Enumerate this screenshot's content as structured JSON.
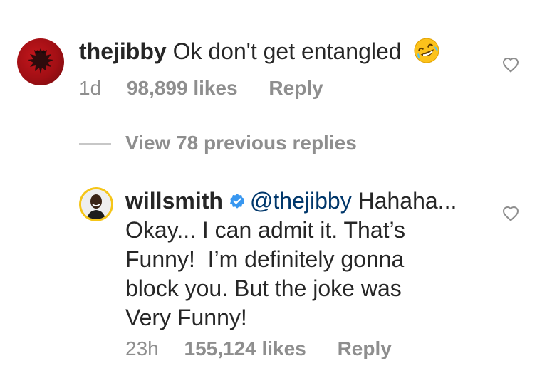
{
  "comment": {
    "username": "thejibby",
    "text": "Ok don't get entangled",
    "emoji": "rolling-on-floor-laughing-emoji",
    "time": "1d",
    "likes": "98,899 likes",
    "reply_label": "Reply"
  },
  "view_replies": {
    "label": "View 78 previous replies"
  },
  "reply": {
    "username": "willsmith",
    "verified": true,
    "mention": "@thejibby",
    "text_lines": [
      " Hahaha...",
      "Okay... I can admit it. That’s",
      "Funny!  I’m definitely gonna",
      "block you. But the joke was",
      "Very Funny!"
    ],
    "time": "23h",
    "likes": "155,124 likes",
    "reply_label": "Reply"
  },
  "colors": {
    "text_primary": "#262626",
    "text_secondary": "#8e8e8e",
    "mention": "#00376b",
    "verified_badge": "#3897f0",
    "avatar_ring": "#f5c518"
  }
}
